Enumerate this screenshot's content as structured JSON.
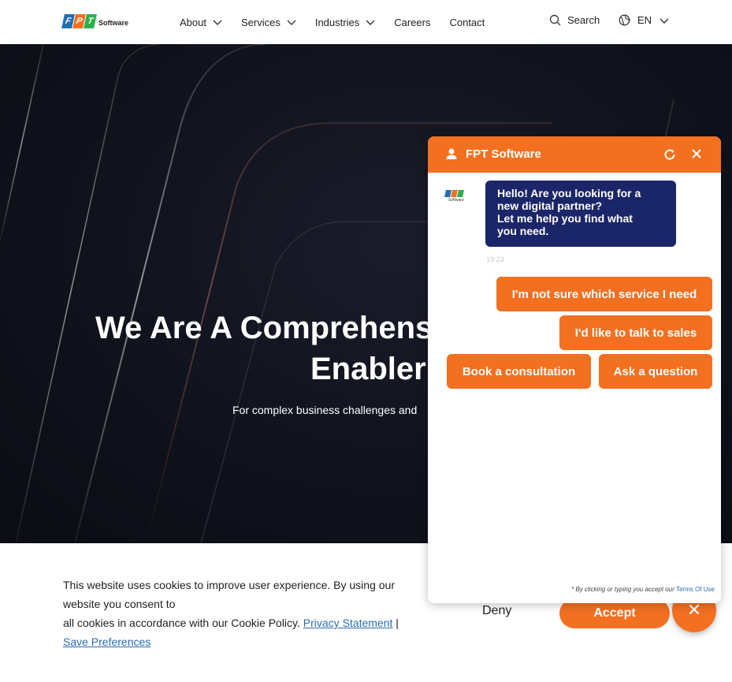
{
  "header": {
    "logo_letters": [
      "F",
      "P",
      "T"
    ],
    "logo_colors": [
      "#1f6fb5",
      "#f37021",
      "#2bb04a"
    ],
    "logo_text": "Software",
    "nav": [
      {
        "label": "About",
        "has_dropdown": true
      },
      {
        "label": "Services",
        "has_dropdown": true
      },
      {
        "label": "Industries",
        "has_dropdown": true
      },
      {
        "label": "Careers",
        "has_dropdown": false
      },
      {
        "label": "Contact",
        "has_dropdown": false
      }
    ],
    "search_label": "Search",
    "language": "EN"
  },
  "hero": {
    "title_line1": "We Are A Comprehensi",
    "title_line2": "Enabler",
    "subtitle": "For complex business challenges and"
  },
  "chat": {
    "title": "FPT Software",
    "greeting_line1": "Hello! Are you looking for a",
    "greeting_line2": "new digital partner?",
    "greeting_line3": "Let me help you find what",
    "greeting_line4": "you need.",
    "timestamp": "19:23",
    "options": [
      "I'm not sure which service I need",
      "I'd like to talk to sales",
      "Book a consultation",
      "Ask a question"
    ],
    "terms_prefix": "* By clicking or typing you accept our",
    "terms_link": "Terms Of Use",
    "accent_color": "#f37021",
    "bubble_color": "#1b2669"
  },
  "cookie": {
    "text_part1": "This website uses cookies to improve user experience. By using our website you consent to",
    "text_part2": "all cookies in accordance with our Cookie Policy.",
    "privacy_link": "Privacy Statement",
    "separator": "|",
    "preferences_link": "Save Preferences",
    "deny_label": "Deny",
    "accept_label": "Accept",
    "close_icon": "✕"
  }
}
